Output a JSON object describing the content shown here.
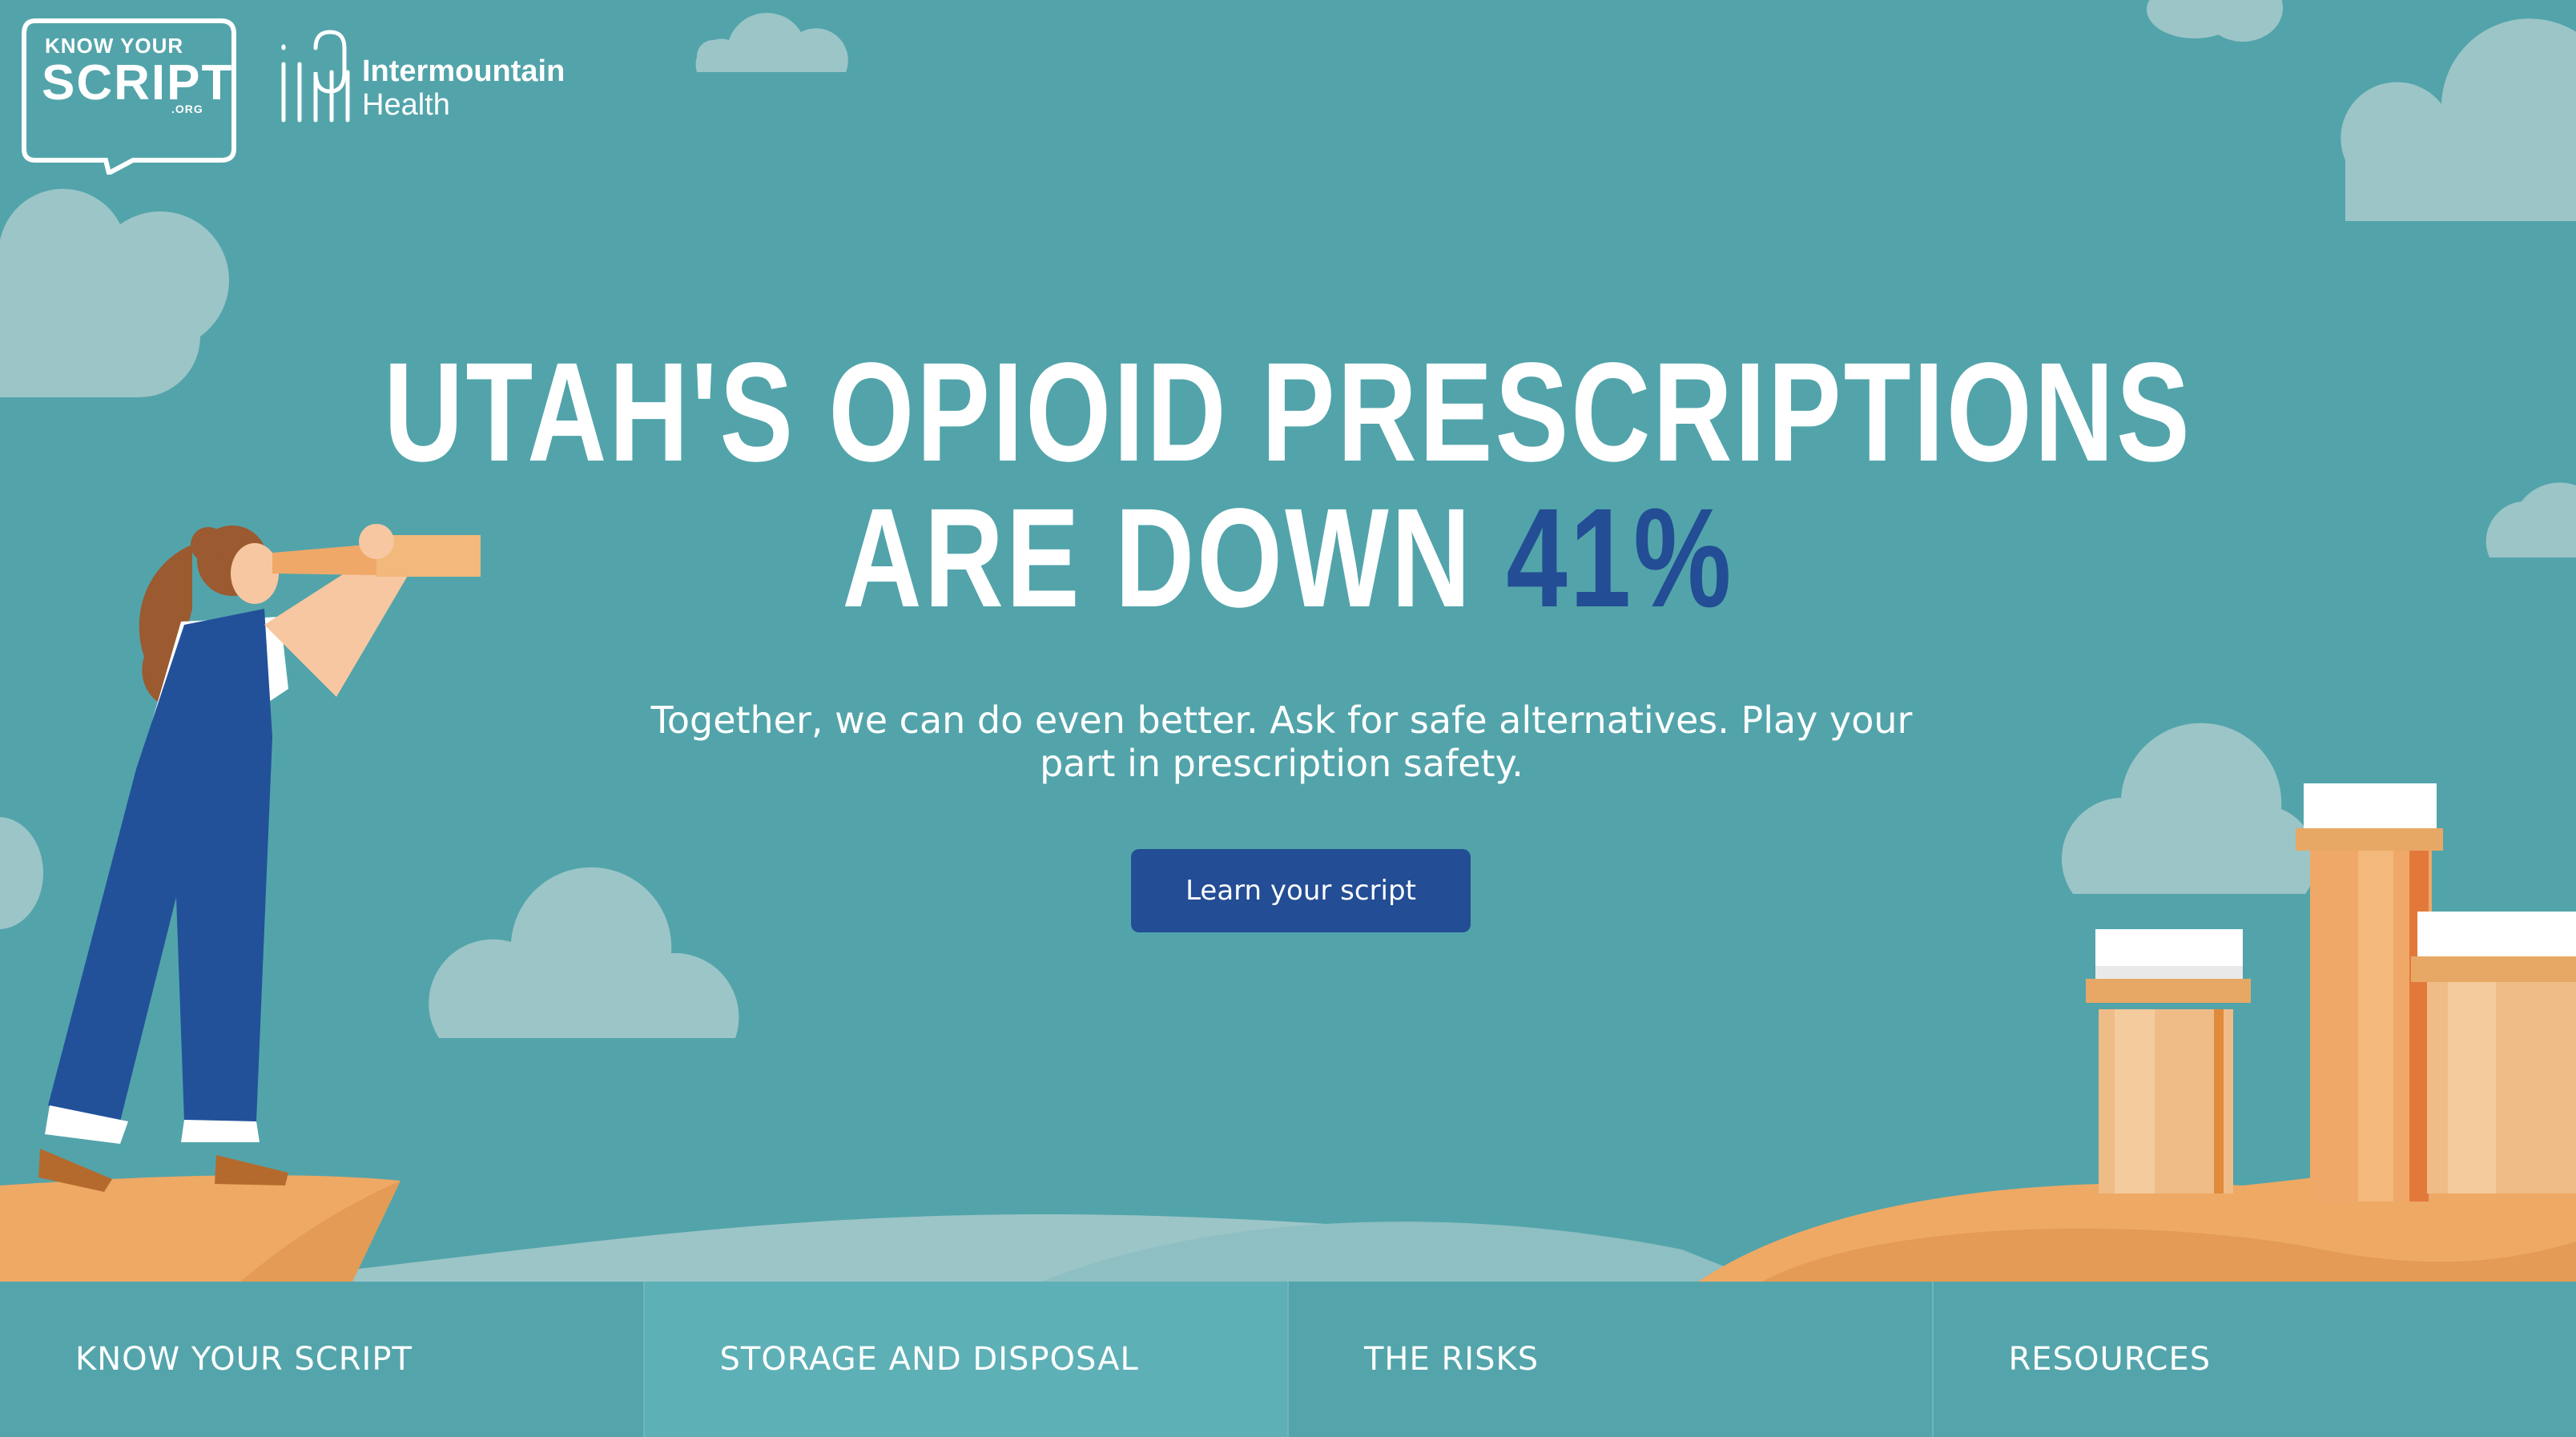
{
  "header": {
    "kys_logo_top": "KNOW YOUR",
    "kys_logo_main": "SCRIPT",
    "kys_logo_org": ".ORG",
    "partner_name": "Intermountain",
    "partner_sub": "Health"
  },
  "hero": {
    "headline_line1": "UTAH'S OPIOID PRESCRIPTIONS",
    "headline_line2_prefix": "ARE DOWN",
    "headline_highlight": "41%",
    "subtext": "Together, we can do even better. Ask for safe alternatives. Play your part in prescription safety.",
    "cta_label": "Learn your script"
  },
  "nav": {
    "items": [
      {
        "label": "KNOW YOUR SCRIPT"
      },
      {
        "label": "STORAGE AND DISPOSAL"
      },
      {
        "label": "THE RISKS"
      },
      {
        "label": "RESOURCES"
      }
    ]
  },
  "colors": {
    "background": "#52a4aa",
    "accent": "#234d94",
    "cloud": "#9cc5c8",
    "sand": "#eea965"
  },
  "icons": [
    "know-your-script-logo",
    "intermountain-logo",
    "woman-telescope-illustration",
    "pill-bottle-illustration",
    "cloud-illustration"
  ]
}
